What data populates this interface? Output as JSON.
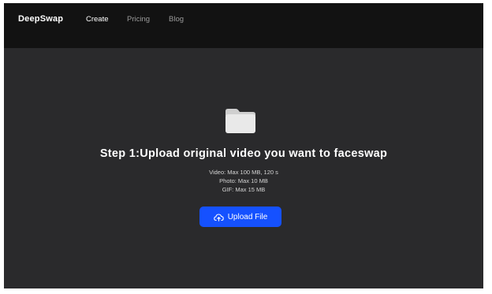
{
  "header": {
    "logo": "DeepSwap",
    "nav": [
      {
        "label": "Create",
        "active": true
      },
      {
        "label": "Pricing",
        "active": false
      },
      {
        "label": "Blog",
        "active": false
      }
    ]
  },
  "main": {
    "icon": "folder-icon",
    "title": "Step 1:Upload original video you want to faceswap",
    "limits": [
      "Video:  Max 100 MB, 120 s",
      "Photo: Max 10 MB",
      "GIF: Max 15 MB"
    ],
    "upload_button": {
      "label": "Upload File",
      "icon": "cloud-upload-icon"
    }
  },
  "colors": {
    "header_bg": "#121212",
    "page_bg": "#2a2a2c",
    "accent": "#1551ff",
    "text": "#ffffff",
    "muted_text": "#9a9a9a"
  }
}
